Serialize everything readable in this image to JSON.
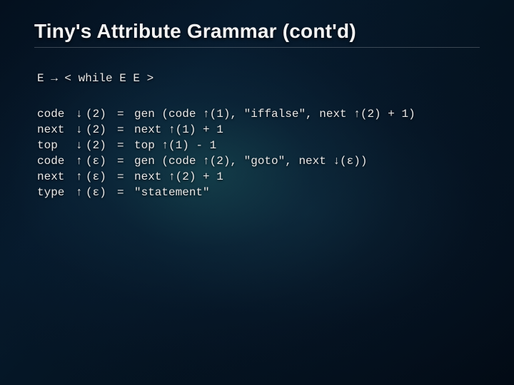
{
  "title": "Tiny's Attribute Grammar (cont'd)",
  "production": "E → < while E E >",
  "arrows": {
    "down": "↓",
    "up": "↑"
  },
  "rows": [
    {
      "name": "code",
      "dir": "down",
      "idx": "(2)",
      "eq": "=",
      "rhs": "gen (code ↑(1), \"iffalse\", next ↑(2) + 1)"
    },
    {
      "name": "next",
      "dir": "down",
      "idx": "(2)",
      "eq": "=",
      "rhs": "next ↑(1) + 1"
    },
    {
      "name": "top",
      "dir": "down",
      "idx": "(2)",
      "eq": "=",
      "rhs": "top ↑(1) - 1"
    },
    {
      "name": "code",
      "dir": "up",
      "idx": "(ε)",
      "eq": "=",
      "rhs": "gen (code ↑(2), \"goto\", next ↓(ε))"
    },
    {
      "name": "next",
      "dir": "up",
      "idx": "(ε)",
      "eq": "=",
      "rhs": "next ↑(2) + 1"
    },
    {
      "name": "type",
      "dir": "up",
      "idx": "(ε)",
      "eq": "=",
      "rhs": "\"statement\""
    }
  ]
}
